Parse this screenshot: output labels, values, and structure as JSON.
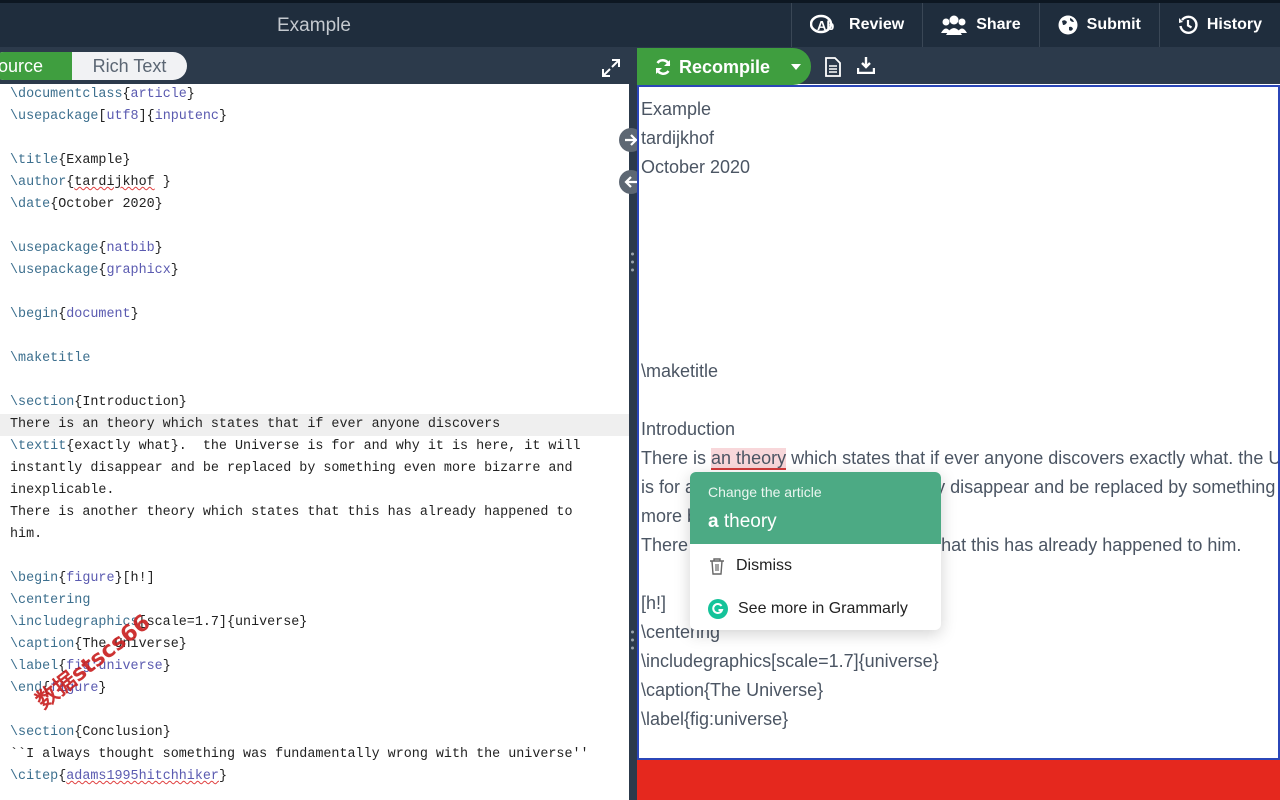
{
  "header": {
    "title": "Example",
    "nav": [
      {
        "label": "Review",
        "icon": "review-icon"
      },
      {
        "label": "Share",
        "icon": "users-icon"
      },
      {
        "label": "Submit",
        "icon": "globe-icon"
      },
      {
        "label": "History",
        "icon": "history-icon"
      }
    ]
  },
  "editor_toolbar": {
    "source_label": "Source",
    "rich_text_label": "Rich Text"
  },
  "editor": {
    "lines": [
      "\\documentclass{article}",
      "\\usepackage[utf8]{inputenc}",
      "",
      "\\title{Example}",
      "\\author{tardijkhof }",
      "\\date{October 2020}",
      "",
      "\\usepackage{natbib}",
      "\\usepackage{graphicx}",
      "",
      "\\begin{document}",
      "",
      "\\maketitle",
      "",
      "\\section{Introduction}",
      "There is an theory which states that if ever anyone discovers",
      "\\textit{exactly what}.  the Universe is for and why it is here, it will",
      "instantly disappear and be replaced by something even more bizarre and",
      "inexplicable.",
      "There is another theory which states that this has already happened to",
      "him.",
      "",
      "\\begin{figure}[h!]",
      "\\centering",
      "\\includegraphics[scale=1.7]{universe}",
      "\\caption{The Universe}",
      "\\label{fig:universe}",
      "\\end{figure}",
      "",
      "\\section{Conclusion}",
      "``I always thought something was fundamentally wrong with the universe''",
      "\\citep{adams1995hitchhiker}"
    ],
    "watermark": "数据stscs66"
  },
  "preview_toolbar": {
    "recompile_label": "Recompile"
  },
  "preview": {
    "lines": [
      "Example",
      "tardijkhof",
      "October 2020",
      "\\maketitle",
      "Introduction",
      "There is ",
      "an theory",
      " which states that if ever anyone discovers exactly what.  the Universe",
      "is for and why it is here, it will instantly disappear and be replaced by something even",
      "more bizarre and inexplicable.",
      "There is another theory which states that this has already happened to him.",
      "[h!]",
      "\\centering",
      "\\includegraphics[scale=1.7]{universe}",
      "\\caption{The Universe}",
      "\\label{fig:universe}"
    ]
  },
  "grammarly_popup": {
    "heading": "Change the article",
    "replacement_article": "a",
    "replacement_word": " theory",
    "dismiss_label": "Dismiss",
    "see_more_label": "See more in Grammarly"
  },
  "colors": {
    "header_bg": "#1f2d3d",
    "toolbar_bg": "#2c3a4b",
    "accent_green": "#3f9e3f",
    "grammarly_green": "#4caa84",
    "error_red": "#e5281e",
    "preview_border": "#2b46b8"
  }
}
